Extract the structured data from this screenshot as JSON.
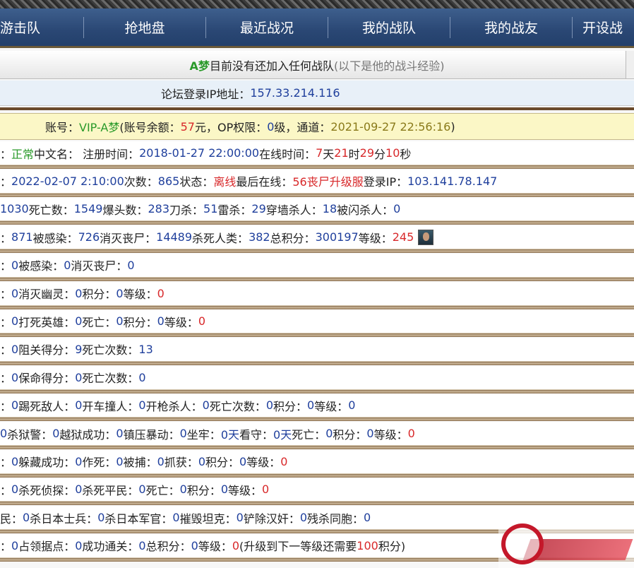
{
  "nav": {
    "items": [
      "游击队",
      "抢地盘",
      "最近战况",
      "我的战队",
      "我的战友",
      "开设战"
    ]
  },
  "notice": {
    "name": "A梦",
    "text": "目前没有还加入任何战队",
    "grey": "(以下是他的战斗经验)"
  },
  "ip": {
    "label": "论坛登录IP地址：",
    "value": "157.33.214.116"
  },
  "account": {
    "label": "账号：",
    "user": "VIP-A梦",
    "balance_label": "(账号余额：",
    "balance": "57",
    "balance_unit": "元，OP权限：",
    "op": "0",
    "op_unit": "级，通道：",
    "date": "2021-09-27 22:56:16",
    "close": ")"
  },
  "rows": [
    {
      "parts": [
        {
          "t": "：",
          "c": "dark"
        },
        {
          "t": "正常",
          "c": "green"
        },
        {
          "t": " 中文名：  注册时间：",
          "c": "dark"
        },
        {
          "t": "2018-01-27 22:00:00",
          "c": "blue"
        },
        {
          "t": " 在线时间：",
          "c": "dark"
        },
        {
          "t": "7",
          "c": "red"
        },
        {
          "t": "天",
          "c": "dark"
        },
        {
          "t": "21",
          "c": "red"
        },
        {
          "t": "时",
          "c": "dark"
        },
        {
          "t": "29",
          "c": "red"
        },
        {
          "t": "分",
          "c": "dark"
        },
        {
          "t": "10",
          "c": "red"
        },
        {
          "t": "秒",
          "c": "dark"
        }
      ]
    },
    {
      "parts": [
        {
          "t": "：",
          "c": "dark"
        },
        {
          "t": "2022-02-07 2:10:00",
          "c": "blue"
        },
        {
          "t": " 次数：",
          "c": "dark"
        },
        {
          "t": "865",
          "c": "blue"
        },
        {
          "t": " 状态：",
          "c": "dark"
        },
        {
          "t": "离线",
          "c": "red"
        },
        {
          "t": " 最后在线：",
          "c": "dark"
        },
        {
          "t": "56丧尸升级服",
          "c": "red"
        },
        {
          "t": " 登录IP：",
          "c": "dark"
        },
        {
          "t": "103.141.78.147",
          "c": "blue"
        }
      ]
    },
    {
      "parts": [
        {
          "t": "1030",
          "c": "blue"
        },
        {
          "t": " 死亡数：",
          "c": "dark"
        },
        {
          "t": "1549",
          "c": "blue"
        },
        {
          "t": " 爆头数：",
          "c": "dark"
        },
        {
          "t": "283",
          "c": "blue"
        },
        {
          "t": " 刀杀：",
          "c": "dark"
        },
        {
          "t": "51",
          "c": "blue"
        },
        {
          "t": " 雷杀：",
          "c": "dark"
        },
        {
          "t": "29",
          "c": "blue"
        },
        {
          "t": " 穿墙杀人：",
          "c": "dark"
        },
        {
          "t": "18",
          "c": "blue"
        },
        {
          "t": " 被闪杀人：",
          "c": "dark"
        },
        {
          "t": "0",
          "c": "blue"
        }
      ]
    },
    {
      "parts": [
        {
          "t": "：",
          "c": "dark"
        },
        {
          "t": "871",
          "c": "blue"
        },
        {
          "t": " 被感染：",
          "c": "dark"
        },
        {
          "t": "726",
          "c": "blue"
        },
        {
          "t": " 消灭丧尸：",
          "c": "dark"
        },
        {
          "t": "14489",
          "c": "blue"
        },
        {
          "t": " 杀死人类：",
          "c": "dark"
        },
        {
          "t": "382",
          "c": "blue"
        },
        {
          "t": " 总积分：",
          "c": "dark"
        },
        {
          "t": "300197",
          "c": "blue"
        },
        {
          "t": " 等级：",
          "c": "dark"
        },
        {
          "t": "245",
          "c": "red"
        }
      ],
      "avatar": true
    },
    {
      "parts": [
        {
          "t": "：",
          "c": "dark"
        },
        {
          "t": "0",
          "c": "blue"
        },
        {
          "t": " 被感染：",
          "c": "dark"
        },
        {
          "t": "0",
          "c": "blue"
        },
        {
          "t": " 消灭丧尸：",
          "c": "dark"
        },
        {
          "t": "0",
          "c": "blue"
        }
      ]
    },
    {
      "parts": [
        {
          "t": "：",
          "c": "dark"
        },
        {
          "t": "0",
          "c": "blue"
        },
        {
          "t": " 消灭幽灵：",
          "c": "dark"
        },
        {
          "t": "0",
          "c": "blue"
        },
        {
          "t": " 积分：",
          "c": "dark"
        },
        {
          "t": "0",
          "c": "blue"
        },
        {
          "t": " 等级：",
          "c": "dark"
        },
        {
          "t": "0",
          "c": "red"
        }
      ]
    },
    {
      "parts": [
        {
          "t": "：",
          "c": "dark"
        },
        {
          "t": "0",
          "c": "blue"
        },
        {
          "t": " 打死英雄：",
          "c": "dark"
        },
        {
          "t": "0",
          "c": "blue"
        },
        {
          "t": " 死亡：",
          "c": "dark"
        },
        {
          "t": "0",
          "c": "blue"
        },
        {
          "t": " 积分：",
          "c": "dark"
        },
        {
          "t": "0",
          "c": "blue"
        },
        {
          "t": " 等级：",
          "c": "dark"
        },
        {
          "t": "0",
          "c": "red"
        }
      ]
    },
    {
      "parts": [
        {
          "t": "：",
          "c": "dark"
        },
        {
          "t": "0",
          "c": "blue"
        },
        {
          "t": " 阻关得分：",
          "c": "dark"
        },
        {
          "t": "9",
          "c": "blue"
        },
        {
          "t": " 死亡次数：",
          "c": "dark"
        },
        {
          "t": "13",
          "c": "blue"
        }
      ]
    },
    {
      "parts": [
        {
          "t": "：",
          "c": "dark"
        },
        {
          "t": "0",
          "c": "blue"
        },
        {
          "t": " 保命得分：",
          "c": "dark"
        },
        {
          "t": "0",
          "c": "blue"
        },
        {
          "t": " 死亡次数：",
          "c": "dark"
        },
        {
          "t": "0",
          "c": "blue"
        }
      ]
    },
    {
      "parts": [
        {
          "t": "：",
          "c": "dark"
        },
        {
          "t": "0",
          "c": "blue"
        },
        {
          "t": " 踢死敌人：",
          "c": "dark"
        },
        {
          "t": "0",
          "c": "blue"
        },
        {
          "t": " 开车撞人：",
          "c": "dark"
        },
        {
          "t": "0",
          "c": "blue"
        },
        {
          "t": " 开枪杀人：",
          "c": "dark"
        },
        {
          "t": "0",
          "c": "blue"
        },
        {
          "t": " 死亡次数：",
          "c": "dark"
        },
        {
          "t": "0",
          "c": "blue"
        },
        {
          "t": " 积分：",
          "c": "dark"
        },
        {
          "t": "0",
          "c": "blue"
        },
        {
          "t": " 等级：",
          "c": "dark"
        },
        {
          "t": "0",
          "c": "blue"
        }
      ]
    },
    {
      "parts": [
        {
          "t": "0",
          "c": "blue"
        },
        {
          "t": " 杀狱警：",
          "c": "dark"
        },
        {
          "t": "0",
          "c": "blue"
        },
        {
          "t": " 越狱成功：",
          "c": "dark"
        },
        {
          "t": "0",
          "c": "blue"
        },
        {
          "t": " 镇压暴动：",
          "c": "dark"
        },
        {
          "t": "0",
          "c": "blue"
        },
        {
          "t": " 坐牢：",
          "c": "dark"
        },
        {
          "t": "0天",
          "c": "blue"
        },
        {
          "t": " 看守：",
          "c": "dark"
        },
        {
          "t": "0天",
          "c": "blue"
        },
        {
          "t": " 死亡：",
          "c": "dark"
        },
        {
          "t": "0",
          "c": "blue"
        },
        {
          "t": " 积分：",
          "c": "dark"
        },
        {
          "t": "0",
          "c": "blue"
        },
        {
          "t": " 等级：",
          "c": "dark"
        },
        {
          "t": "0",
          "c": "red"
        }
      ]
    },
    {
      "parts": [
        {
          "t": "：",
          "c": "dark"
        },
        {
          "t": "0",
          "c": "blue"
        },
        {
          "t": " 躲藏成功：",
          "c": "dark"
        },
        {
          "t": "0",
          "c": "blue"
        },
        {
          "t": " 作死：",
          "c": "dark"
        },
        {
          "t": "0",
          "c": "blue"
        },
        {
          "t": " 被捕：",
          "c": "dark"
        },
        {
          "t": "0",
          "c": "blue"
        },
        {
          "t": " 抓获：",
          "c": "dark"
        },
        {
          "t": "0",
          "c": "blue"
        },
        {
          "t": " 积分：",
          "c": "dark"
        },
        {
          "t": "0",
          "c": "blue"
        },
        {
          "t": " 等级：",
          "c": "dark"
        },
        {
          "t": "0",
          "c": "red"
        }
      ]
    },
    {
      "parts": [
        {
          "t": "：",
          "c": "dark"
        },
        {
          "t": "0",
          "c": "blue"
        },
        {
          "t": " 杀死侦探：",
          "c": "dark"
        },
        {
          "t": "0",
          "c": "blue"
        },
        {
          "t": " 杀死平民：",
          "c": "dark"
        },
        {
          "t": "0",
          "c": "blue"
        },
        {
          "t": " 死亡：",
          "c": "dark"
        },
        {
          "t": "0",
          "c": "blue"
        },
        {
          "t": " 积分：",
          "c": "dark"
        },
        {
          "t": "0",
          "c": "blue"
        },
        {
          "t": " 等级：",
          "c": "dark"
        },
        {
          "t": "0",
          "c": "red"
        }
      ]
    },
    {
      "parts": [
        {
          "t": "民：",
          "c": "dark"
        },
        {
          "t": "0",
          "c": "blue"
        },
        {
          "t": " 杀日本士兵：",
          "c": "dark"
        },
        {
          "t": "0",
          "c": "blue"
        },
        {
          "t": " 杀日本军官：",
          "c": "dark"
        },
        {
          "t": "0",
          "c": "blue"
        },
        {
          "t": " 摧毁坦克：",
          "c": "dark"
        },
        {
          "t": "0",
          "c": "blue"
        },
        {
          "t": " 铲除汉奸：",
          "c": "dark"
        },
        {
          "t": "0",
          "c": "blue"
        },
        {
          "t": " 残杀同胞：",
          "c": "dark"
        },
        {
          "t": "0",
          "c": "blue"
        }
      ]
    },
    {
      "parts": [
        {
          "t": "：",
          "c": "dark"
        },
        {
          "t": "0",
          "c": "blue"
        },
        {
          "t": " 占领据点：",
          "c": "dark"
        },
        {
          "t": "0",
          "c": "blue"
        },
        {
          "t": " 成功通关：",
          "c": "dark"
        },
        {
          "t": "0",
          "c": "blue"
        },
        {
          "t": " 总积分：",
          "c": "dark"
        },
        {
          "t": "0",
          "c": "blue"
        },
        {
          "t": " 等级：",
          "c": "dark"
        },
        {
          "t": "0",
          "c": "red"
        },
        {
          "t": " (升级到下一等级还需要",
          "c": "dark"
        },
        {
          "t": "100",
          "c": "red"
        },
        {
          "t": "积分)",
          "c": "dark"
        }
      ]
    }
  ],
  "colors": {
    "nav_bg": "#2a4774",
    "value_blue": "#1f3f9c",
    "value_red": "#d8282a",
    "value_green": "#2a9a2a",
    "account_bg": "#fbf7c6",
    "divider_brown": "#6b4a2b"
  },
  "logo": {
    "icon": "brand-logo-icon"
  }
}
